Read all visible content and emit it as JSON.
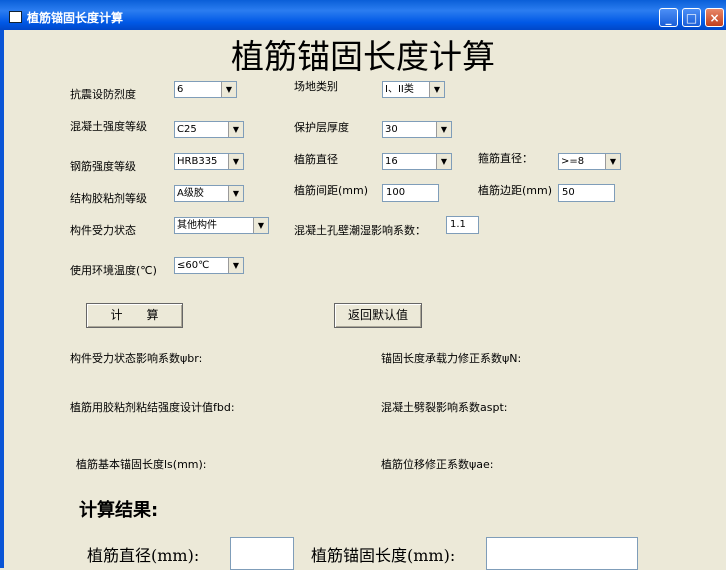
{
  "window": {
    "title": "植筋锚固长度计算"
  },
  "heading": "植筋锚固长度计算",
  "form": {
    "seismic": {
      "label": "抗震设防烈度",
      "value": "6"
    },
    "site": {
      "label": "场地类别",
      "value": "I、II类"
    },
    "concrete": {
      "label": "混凝土强度等级",
      "value": "C25"
    },
    "cover": {
      "label": "保护层厚度",
      "value": "30"
    },
    "steel": {
      "label": "钢筋强度等级",
      "value": "HRB335"
    },
    "bar_dia": {
      "label": "植筋直径",
      "value": "16"
    },
    "stirrup": {
      "label": "箍筋直径：",
      "value": ">=8"
    },
    "adhesive": {
      "label": "结构胶粘剂等级",
      "value": "A级胶"
    },
    "spacing": {
      "label": "植筋间距(mm)",
      "value": "100"
    },
    "edge": {
      "label": "植筋边距(mm)",
      "value": "50"
    },
    "stress": {
      "label": "构件受力状态",
      "value": "其他构件"
    },
    "wet": {
      "label": "混凝土孔壁潮湿影响系数：",
      "value": "1.1"
    },
    "temp": {
      "label": "使用环境温度(℃)",
      "value": "≤60℃"
    }
  },
  "buttons": {
    "calc": "计　　算",
    "reset": "返回默认值"
  },
  "coeffs": {
    "psi_br": "构件受力状态影响系数ψbr:",
    "psi_n": "锚固长度承载力修正系数ψN:",
    "fbd": "植筋用胶粘剂粘结强度设计值fbd:",
    "aspt": "混凝土劈裂影响系数aspt:",
    "ls": "植筋基本锚固长度ls(mm):",
    "psi_ae": "植筋位移修正系数ψae:"
  },
  "results": {
    "heading": "计算结果:",
    "dia_label": "植筋直径(mm):",
    "dia_value": "",
    "len_label": "植筋锚固长度(mm):",
    "len_value": ""
  },
  "icons": {
    "minimize": "minimize-icon",
    "maximize": "maximize-icon",
    "close": "close-icon",
    "dropdown": "chevron-down-icon"
  },
  "colors": {
    "titlebar": "#0058e6",
    "background": "#ece9d8"
  }
}
